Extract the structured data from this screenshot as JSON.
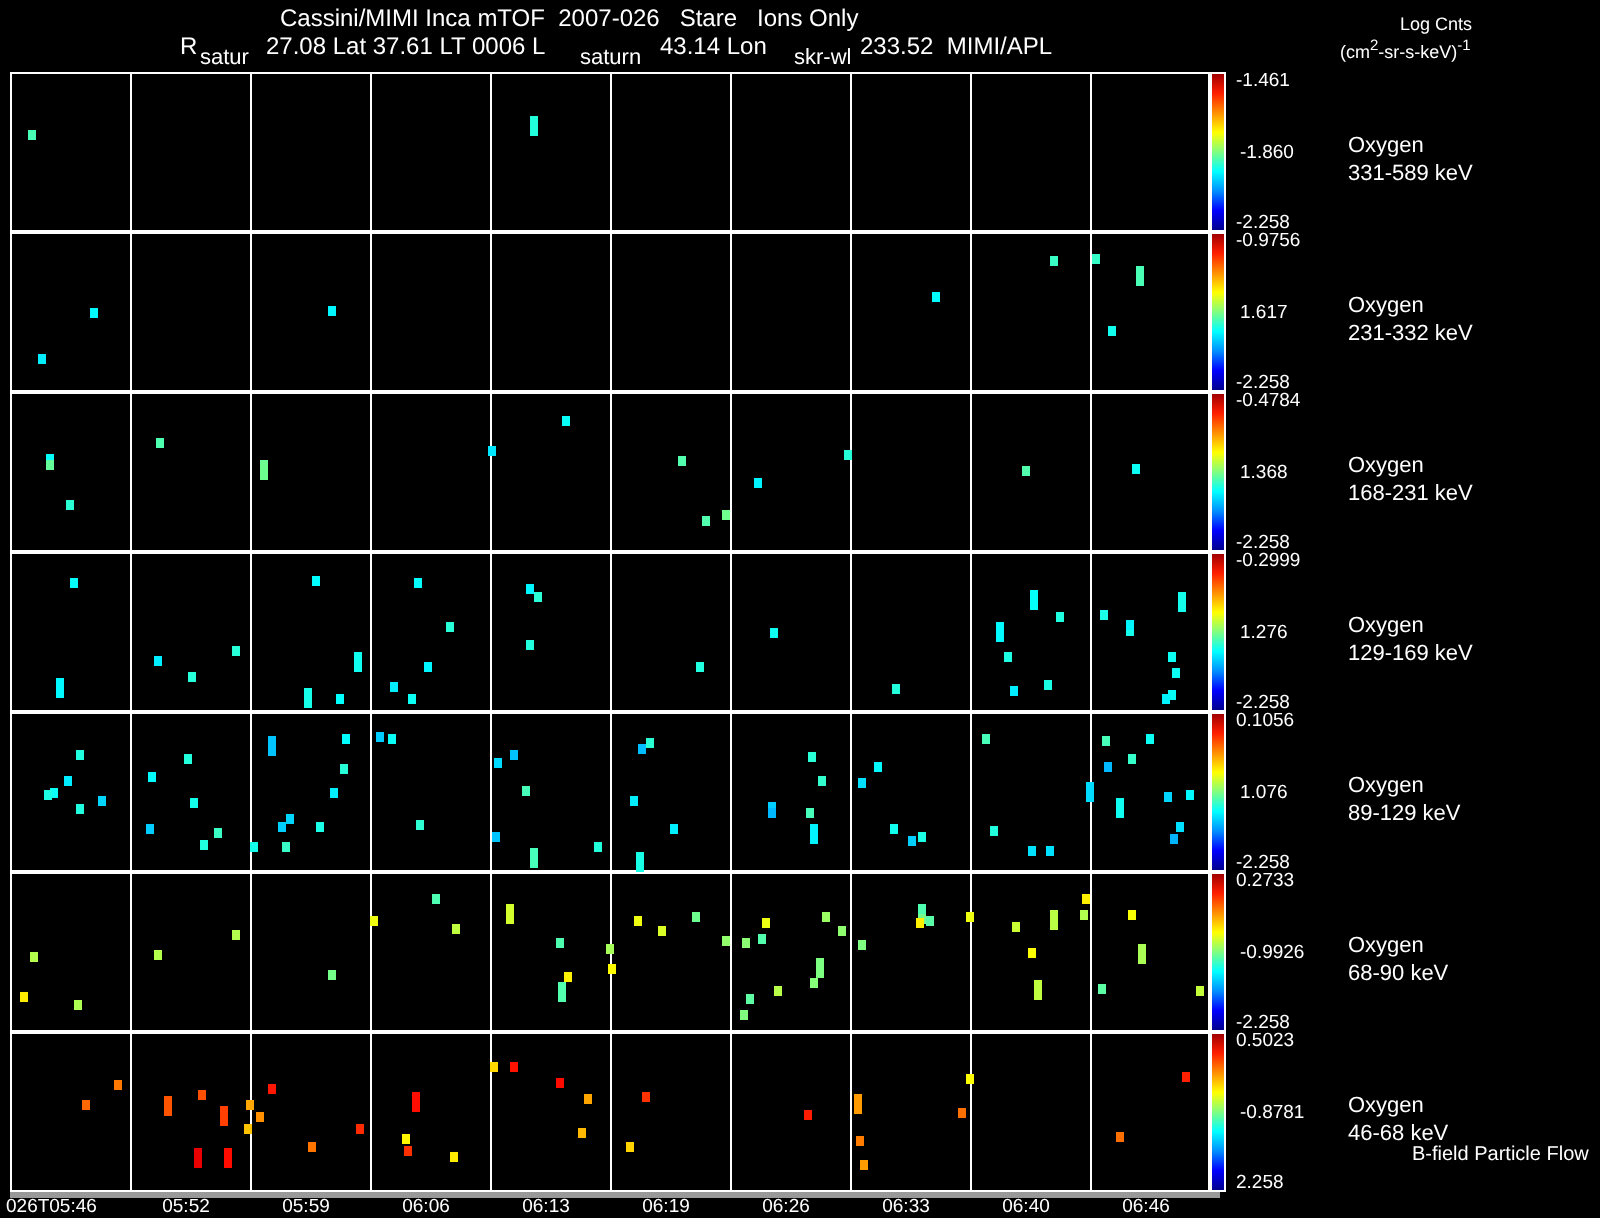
{
  "title": {
    "main": "Cassini/MIMI Inca mTOF  2007-026   Stare   Ions Only",
    "position": [
      "R",
      "27.08 Lat 37.61 LT 0006 L",
      "43.14 Lon",
      "233.52  MIMI/APL"
    ],
    "markers": [
      "satur",
      "saturn",
      "skr-wl"
    ]
  },
  "units": {
    "label": "Log Cnts",
    "unit": "(cm$^{2}$-sr-s-keV)$^{-1}$"
  },
  "panels": [
    {
      "species": "Oxygen",
      "energy": "331-589 keV",
      "max": "-1.461",
      "mid": "-1.860",
      "min": "-2.258"
    },
    {
      "species": "Oxygen",
      "energy": "231-332 keV",
      "max": "-0.9756",
      "mid": "1.617",
      "min": "-2.258"
    },
    {
      "species": "Oxygen",
      "energy": "168-231 keV",
      "max": "-0.4784",
      "mid": "1.368",
      "min": "-2.258"
    },
    {
      "species": "Oxygen",
      "energy": "129-169 keV",
      "max": "-0.2999",
      "mid": "1.276",
      "min": "-2.258"
    },
    {
      "species": "Oxygen",
      "energy": "89-129 keV",
      "max": "0.1056",
      "mid": "1.076",
      "min": "-2.258"
    },
    {
      "species": "Oxygen",
      "energy": "68-90 keV",
      "max": "0.2733",
      "mid": "-0.9926",
      "min": "-2.258"
    },
    {
      "species": "Oxygen",
      "energy": "46-68 keV",
      "max": "0.5023",
      "mid": "-0.8781",
      "min": "2.258"
    }
  ],
  "footnote": "B-field Particle Flow",
  "time_axis": [
    "026T05:46",
    "05:52",
    "05:59",
    "06:06",
    "06:13",
    "06:19",
    "06:26",
    "06:33",
    "06:40",
    "06:46"
  ]
}
